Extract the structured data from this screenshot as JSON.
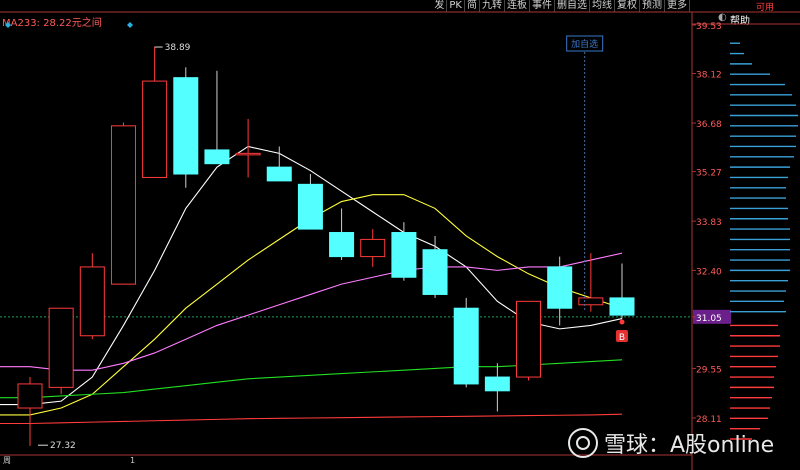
{
  "toolbar": [
    "发",
    "PK",
    "简",
    "九转",
    "连板",
    "事件",
    "删自选",
    "均线",
    "复权"
  ],
  "toolbar_tail": "预测",
  "toolbar_more": "更多",
  "help_label": "帮助",
  "top_right_label": "可用",
  "ma_label": "MA233: 28.22元之间",
  "watermark": "雪球：A股online",
  "tooltip": "加自选",
  "marker_b": "B",
  "bottom_labels": [
    "周",
    "1"
  ],
  "colors": {
    "up": "#ff3b3b",
    "down": "#54ffff",
    "ma5": "#ffffff",
    "ma10": "#ffff3c",
    "ma20": "#ff7cff",
    "ma60": "#22e022",
    "ma233": "#ff3b3b"
  },
  "chart_data": {
    "type": "candlestick",
    "y_ticks": [
      39.53,
      38.12,
      36.68,
      35.27,
      33.83,
      32.4,
      31.05,
      29.55,
      28.11
    ],
    "current_price": 31.05,
    "ylim": [
      27.0,
      40.0
    ],
    "annotations": [
      {
        "label": "38.89",
        "value": 38.89
      },
      {
        "label": "27.32",
        "value": 27.32
      }
    ],
    "candles": [
      {
        "o": 28.4,
        "h": 29.3,
        "l": 27.3,
        "c": 29.1
      },
      {
        "o": 29.0,
        "h": 31.3,
        "l": 28.8,
        "c": 31.3
      },
      {
        "o": 30.5,
        "h": 32.9,
        "l": 30.4,
        "c": 32.5
      },
      {
        "o": 32.0,
        "h": 36.7,
        "l": 32.0,
        "c": 36.6
      },
      {
        "o": 35.1,
        "h": 38.9,
        "l": 35.1,
        "c": 37.9
      },
      {
        "o": 38.0,
        "h": 38.3,
        "l": 34.8,
        "c": 35.2
      },
      {
        "o": 35.9,
        "h": 38.2,
        "l": 35.5,
        "c": 35.5
      },
      {
        "o": 35.8,
        "h": 36.8,
        "l": 35.1,
        "c": 35.8
      },
      {
        "o": 35.4,
        "h": 36.0,
        "l": 35.0,
        "c": 35.0
      },
      {
        "o": 34.9,
        "h": 35.2,
        "l": 33.7,
        "c": 33.6
      },
      {
        "o": 33.5,
        "h": 34.2,
        "l": 32.7,
        "c": 32.8
      },
      {
        "o": 32.8,
        "h": 33.6,
        "l": 32.5,
        "c": 33.3
      },
      {
        "o": 33.5,
        "h": 33.8,
        "l": 32.1,
        "c": 32.2
      },
      {
        "o": 33.0,
        "h": 33.4,
        "l": 31.6,
        "c": 31.7
      },
      {
        "o": 31.3,
        "h": 31.6,
        "l": 29.0,
        "c": 29.1
      },
      {
        "o": 29.3,
        "h": 29.7,
        "l": 28.3,
        "c": 28.9
      },
      {
        "o": 29.3,
        "h": 31.5,
        "l": 29.2,
        "c": 31.5
      },
      {
        "o": 32.5,
        "h": 32.8,
        "l": 30.8,
        "c": 31.3
      },
      {
        "o": 31.4,
        "h": 32.9,
        "l": 31.2,
        "c": 31.6
      },
      {
        "o": 31.6,
        "h": 32.6,
        "l": 31.0,
        "c": 31.1
      }
    ],
    "ma_lines": [
      {
        "key": "ma5",
        "values": [
          28.5,
          28.6,
          29.3,
          30.8,
          32.4,
          34.2,
          35.4,
          36.0,
          35.8,
          35.3,
          34.7,
          34.1,
          33.5,
          33.1,
          32.5,
          31.5,
          30.9,
          30.7,
          30.8,
          31.0
        ]
      },
      {
        "key": "ma10",
        "values": [
          28.2,
          28.4,
          28.8,
          29.6,
          30.4,
          31.3,
          32.0,
          32.7,
          33.3,
          33.9,
          34.4,
          34.6,
          34.6,
          34.2,
          33.4,
          32.8,
          32.3,
          31.9,
          31.6,
          31.3
        ]
      },
      {
        "key": "ma20",
        "values": [
          29.6,
          29.5,
          29.5,
          29.7,
          30.0,
          30.4,
          30.8,
          31.1,
          31.4,
          31.7,
          32.0,
          32.2,
          32.4,
          32.5,
          32.5,
          32.4,
          32.5,
          32.5,
          32.7,
          32.9
        ]
      },
      {
        "key": "ma60",
        "values": [
          28.7,
          28.75,
          28.8,
          28.85,
          28.95,
          29.05,
          29.15,
          29.25,
          29.3,
          29.35,
          29.4,
          29.45,
          29.5,
          29.55,
          29.6,
          29.6,
          29.65,
          29.7,
          29.75,
          29.8
        ]
      },
      {
        "key": "ma233",
        "values": [
          27.95,
          27.97,
          27.99,
          28.01,
          28.03,
          28.05,
          28.07,
          28.09,
          28.1,
          28.11,
          28.12,
          28.13,
          28.14,
          28.15,
          28.16,
          28.17,
          28.18,
          28.19,
          28.2,
          28.22
        ]
      }
    ],
    "volume_profile": [
      {
        "price": 39.0,
        "len": 10,
        "type": "down"
      },
      {
        "price": 38.7,
        "len": 14,
        "type": "down"
      },
      {
        "price": 38.4,
        "len": 22,
        "type": "down"
      },
      {
        "price": 38.1,
        "len": 40,
        "type": "down"
      },
      {
        "price": 37.8,
        "len": 55,
        "type": "down"
      },
      {
        "price": 37.5,
        "len": 62,
        "type": "down"
      },
      {
        "price": 37.2,
        "len": 66,
        "type": "down"
      },
      {
        "price": 36.9,
        "len": 68,
        "type": "down"
      },
      {
        "price": 36.6,
        "len": 68,
        "type": "down"
      },
      {
        "price": 36.3,
        "len": 66,
        "type": "down"
      },
      {
        "price": 36.0,
        "len": 66,
        "type": "down"
      },
      {
        "price": 35.7,
        "len": 64,
        "type": "down"
      },
      {
        "price": 35.4,
        "len": 60,
        "type": "down"
      },
      {
        "price": 35.1,
        "len": 58,
        "type": "down"
      },
      {
        "price": 34.8,
        "len": 56,
        "type": "down"
      },
      {
        "price": 34.5,
        "len": 56,
        "type": "down"
      },
      {
        "price": 34.2,
        "len": 58,
        "type": "down"
      },
      {
        "price": 33.9,
        "len": 58,
        "type": "down"
      },
      {
        "price": 33.6,
        "len": 60,
        "type": "down"
      },
      {
        "price": 33.3,
        "len": 60,
        "type": "down"
      },
      {
        "price": 33.0,
        "len": 60,
        "type": "down"
      },
      {
        "price": 32.7,
        "len": 60,
        "type": "down"
      },
      {
        "price": 32.4,
        "len": 60,
        "type": "down"
      },
      {
        "price": 32.1,
        "len": 58,
        "type": "down"
      },
      {
        "price": 31.8,
        "len": 56,
        "type": "down"
      },
      {
        "price": 31.5,
        "len": 54,
        "type": "down"
      },
      {
        "price": 31.2,
        "len": 56,
        "type": "down"
      },
      {
        "price": 30.8,
        "len": 48,
        "type": "up"
      },
      {
        "price": 30.5,
        "len": 50,
        "type": "up"
      },
      {
        "price": 30.2,
        "len": 50,
        "type": "up"
      },
      {
        "price": 29.9,
        "len": 48,
        "type": "up"
      },
      {
        "price": 29.6,
        "len": 46,
        "type": "up"
      },
      {
        "price": 29.3,
        "len": 44,
        "type": "up"
      },
      {
        "price": 29.0,
        "len": 44,
        "type": "up"
      },
      {
        "price": 28.7,
        "len": 42,
        "type": "up"
      },
      {
        "price": 28.4,
        "len": 40,
        "type": "up"
      },
      {
        "price": 28.1,
        "len": 38,
        "type": "up"
      },
      {
        "price": 27.8,
        "len": 30,
        "type": "up"
      },
      {
        "price": 27.5,
        "len": 22,
        "type": "up"
      }
    ]
  }
}
